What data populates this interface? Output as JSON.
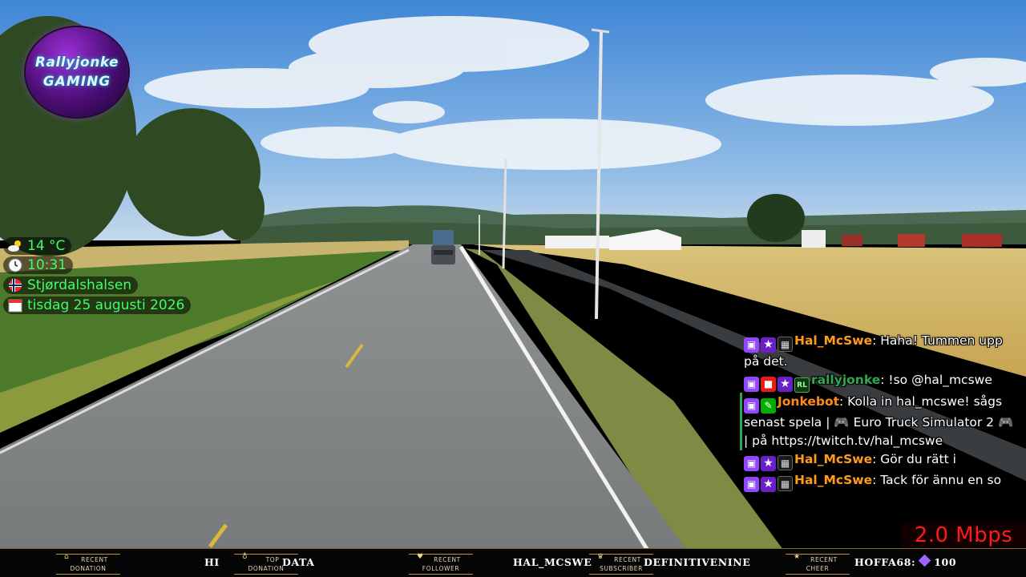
{
  "logo": {
    "line1": "Rallyjonke",
    "line2": "GAMING"
  },
  "info": {
    "weather": {
      "icon": "partly-cloudy-icon",
      "text": "14 °C"
    },
    "time": {
      "icon": "clock-icon",
      "text": "10:31"
    },
    "location": {
      "icon": "norway-flag-icon",
      "text": "Stjørdalshalsen"
    },
    "date": {
      "icon": "calendar-icon",
      "text": "tisdag 25 augusti 2026"
    }
  },
  "chat": {
    "messages": [
      {
        "user": "Hal_McSwe",
        "text": ": Haha! Tummen upp på det."
      },
      {
        "user": "rallyjonke",
        "text": ": !so @hal_mcswe"
      },
      {
        "user": "Jonkebot",
        "text": ": Kolla in hal_mcswe! sågs senast spela | 🎮 Euro Truck Simulator 2 🎮 | på https://twitch.tv/hal_mcswe"
      },
      {
        "user": "Hal_McSwe",
        "text": ": Gör du rätt i"
      },
      {
        "user": "Hal_McSwe",
        "text": ": Tack för ännu en so"
      }
    ]
  },
  "bitrate": "2.0 Mbps",
  "bottom_bar": {
    "recent_donation": {
      "label1": "RECENT",
      "label2": "DONATION",
      "value": "HI"
    },
    "top_donation": {
      "label1": "TOP",
      "label2": "DONATION",
      "value": "DATA"
    },
    "recent_follower": {
      "label1": "RECENT",
      "label2": "FOLLOWER",
      "value": "HAL_MCSWE"
    },
    "recent_subscriber": {
      "label1": "RECENT",
      "label2": "SUBSCRIBER",
      "value": "DEFINITIVENINE"
    },
    "recent_cheer": {
      "label1": "RECENT",
      "label2": "CHEER",
      "user": "HOFFA68:",
      "amount": "100"
    }
  },
  "colors": {
    "overlay_green": "#3dff6b",
    "nick_orange": "#ff9d1a",
    "bitrate_red": "#ff1a1a",
    "gold": "#b8933a"
  }
}
